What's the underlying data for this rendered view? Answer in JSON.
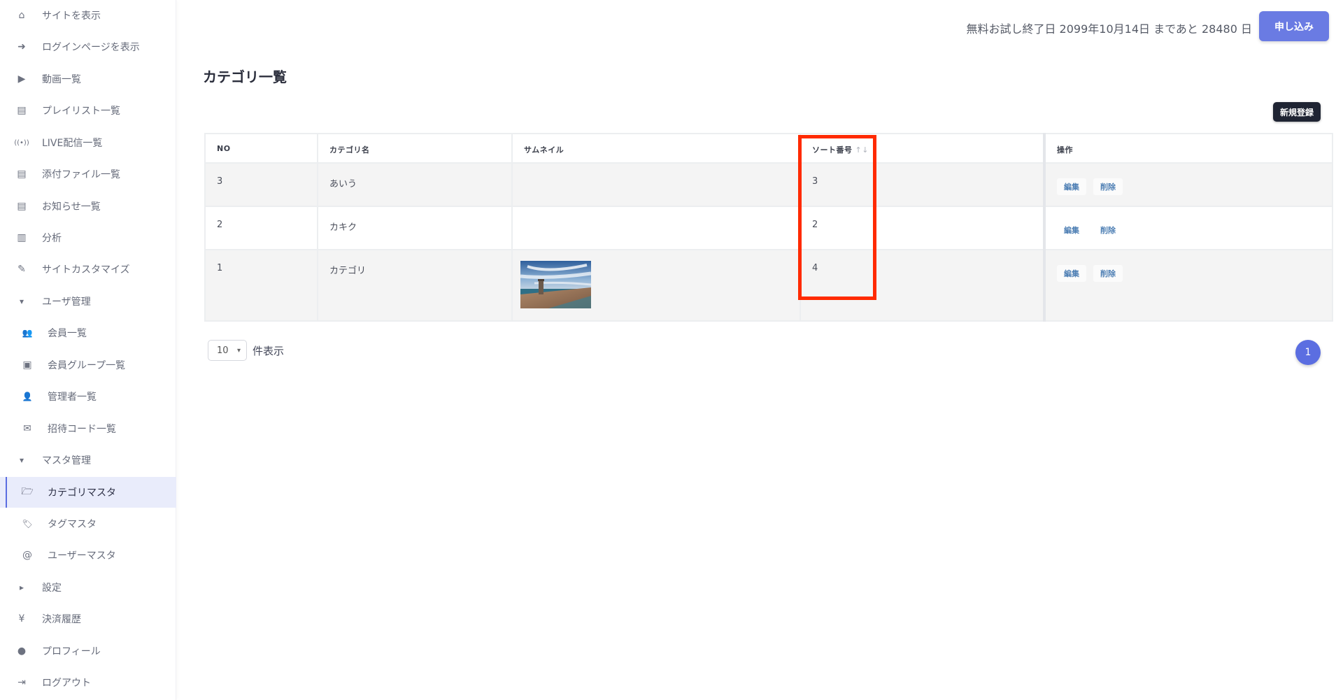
{
  "sidebar": {
    "items": [
      {
        "label": "サイトを表示",
        "icon": "home-icon",
        "glyph": "⌂"
      },
      {
        "label": "ログインページを表示",
        "icon": "sign-in-icon",
        "glyph": "➜"
      },
      {
        "label": "動画一覧",
        "icon": "video-icon",
        "glyph": "▶"
      },
      {
        "label": "プレイリスト一覧",
        "icon": "images-icon",
        "glyph": "▤"
      },
      {
        "label": "LIVE配信一覧",
        "icon": "broadcast-icon",
        "glyph": "((•))"
      },
      {
        "label": "添付ファイル一覧",
        "icon": "attachments-icon",
        "glyph": "▤"
      },
      {
        "label": "お知らせ一覧",
        "icon": "notice-icon",
        "glyph": "▤"
      },
      {
        "label": "分析",
        "icon": "chart-icon",
        "glyph": "▥"
      },
      {
        "label": "サイトカスタマイズ",
        "icon": "edit-icon",
        "glyph": "✎"
      },
      {
        "label": "ユーザ管理",
        "icon": "caret-down-icon",
        "glyph": "▾"
      },
      {
        "label": "会員一覧",
        "icon": "users-icon",
        "glyph": "👥"
      },
      {
        "label": "会員グループ一覧",
        "icon": "group-icon",
        "glyph": "▣"
      },
      {
        "label": "管理者一覧",
        "icon": "admin-icon",
        "glyph": "👤"
      },
      {
        "label": "招待コード一覧",
        "icon": "envelope-icon",
        "glyph": "✉"
      },
      {
        "label": "マスタ管理",
        "icon": "caret-down-icon",
        "glyph": "▾"
      },
      {
        "label": "カテゴリマスタ",
        "icon": "folder-open-icon",
        "glyph": "🗁"
      },
      {
        "label": "タグマスタ",
        "icon": "tags-icon",
        "glyph": "🏷"
      },
      {
        "label": "ユーザーマスタ",
        "icon": "at-icon",
        "glyph": "@"
      },
      {
        "label": "設定",
        "icon": "caret-right-icon",
        "glyph": "▸"
      },
      {
        "label": "決済履歴",
        "icon": "yen-icon",
        "glyph": "¥"
      },
      {
        "label": "プロフィール",
        "icon": "user-circle-icon",
        "glyph": "●"
      },
      {
        "label": "ログアウト",
        "icon": "sign-out-icon",
        "glyph": "⇥"
      }
    ]
  },
  "header": {
    "trial_text": "無料お試し終了日 2099年10月14日 まであと 28480 日",
    "apply_label": "申し込み"
  },
  "page_title": "カテゴリ一覧",
  "new_button_label": "新規登録",
  "table": {
    "headers": [
      "NO",
      "カテゴリ名",
      "サムネイル",
      "ソート番号",
      "操作"
    ],
    "sort_indicator": "↑↓",
    "rows": [
      {
        "no": "3",
        "name": "あいう",
        "sort": "3",
        "edit": "編集",
        "delete": "削除"
      },
      {
        "no": "2",
        "name": "カキク",
        "sort": "2",
        "edit": "編集",
        "delete": "削除"
      },
      {
        "no": "1",
        "name": "カテゴリ",
        "sort": "4",
        "edit": "編集",
        "delete": "削除"
      }
    ]
  },
  "footer": {
    "per_page_value": "10",
    "per_page_label": "件表示",
    "current_page": "1"
  },
  "colors": {
    "accent": "#5b6ee1",
    "highlight": "#ff2a00",
    "dark_button": "#1f2433"
  }
}
